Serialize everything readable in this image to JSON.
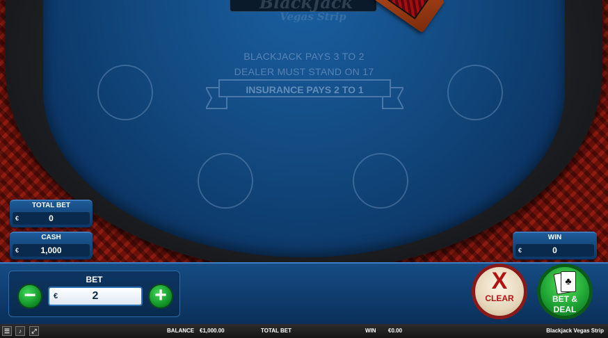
{
  "table": {
    "logo_line1": "BlackJack",
    "logo_line2": "Vegas Strip",
    "rule1": "BLACKJACK PAYS 3 TO 2",
    "rule2": "DEALER MUST STAND ON 17",
    "insurance": "INSURANCE PAYS 2 TO 1"
  },
  "panels": {
    "total_bet": {
      "label": "TOTAL BET",
      "currency": "€",
      "value": "0"
    },
    "cash": {
      "label": "CASH",
      "currency": "€",
      "value": "1,000"
    },
    "win": {
      "label": "WIN",
      "currency": "€",
      "value": "0"
    }
  },
  "bet": {
    "label": "BET",
    "currency": "€",
    "value": "2",
    "minus": "−",
    "plus": "+"
  },
  "buttons": {
    "clear_symbol": "X",
    "clear_label": "CLEAR",
    "deal_line1": "BET &",
    "deal_line2": "DEAL"
  },
  "statusbar": {
    "icons": [
      "menu-icon",
      "sound-icon",
      "fullscreen-icon"
    ],
    "balance_label": "BALANCE",
    "balance_value": "€1,000.00",
    "total_bet_label": "TOTAL BET",
    "win_label": "WIN",
    "win_value": "€0.00",
    "game_title": "Blackjack Vegas Strip"
  },
  "colors": {
    "felt": "#12497f",
    "panel": "#1d5a96",
    "clear_red": "#b31212",
    "deal_green": "#1ca032"
  }
}
